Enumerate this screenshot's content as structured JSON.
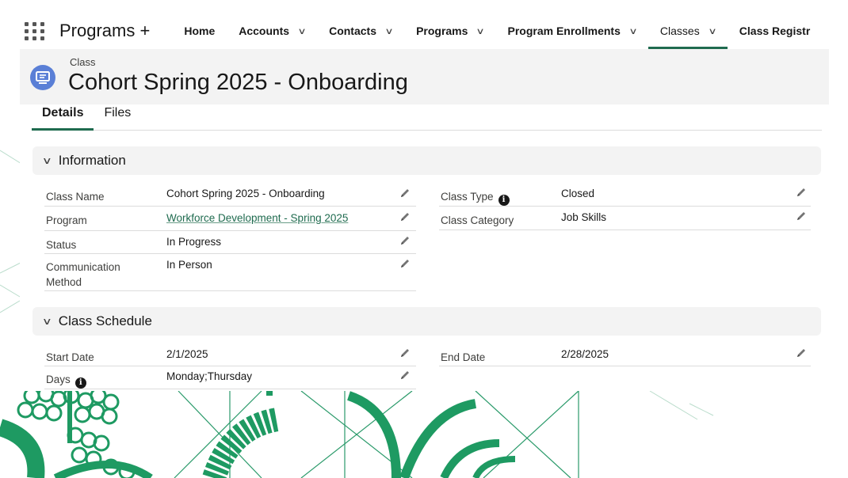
{
  "app": {
    "name": "Programs +"
  },
  "nav": {
    "items": [
      {
        "label": "Home",
        "has_menu": false,
        "active": false
      },
      {
        "label": "Accounts",
        "has_menu": true,
        "active": false
      },
      {
        "label": "Contacts",
        "has_menu": true,
        "active": false
      },
      {
        "label": "Programs",
        "has_menu": true,
        "active": false
      },
      {
        "label": "Program Enrollments",
        "has_menu": true,
        "active": false
      },
      {
        "label": "Classes",
        "has_menu": true,
        "active": true
      },
      {
        "label": "Class Registr",
        "has_menu": false,
        "active": false
      }
    ]
  },
  "record": {
    "object_type": "Class",
    "title": "Cohort Spring 2025 - Onboarding"
  },
  "tabs": [
    "Details",
    "Files"
  ],
  "sections": {
    "information": {
      "title": "Information"
    },
    "schedule": {
      "title": "Class Schedule"
    }
  },
  "fields": {
    "class_name": {
      "label": "Class Name",
      "value": "Cohort Spring 2025 - Onboarding"
    },
    "program": {
      "label": "Program",
      "value": "Workforce Development - Spring 2025"
    },
    "status": {
      "label": "Status",
      "value": "In Progress"
    },
    "communication_method": {
      "label_line1": "Communication",
      "label_line2": "Method",
      "value": "In Person"
    },
    "class_type": {
      "label": "Class Type",
      "value": "Closed"
    },
    "class_category": {
      "label": "Class Category",
      "value": "Job Skills"
    },
    "start_date": {
      "label": "Start Date",
      "value": "2/1/2025"
    },
    "days": {
      "label": "Days",
      "value": "Monday;Thursday"
    },
    "end_date": {
      "label": "End Date",
      "value": "2/28/2025"
    }
  },
  "icons": {
    "app_launcher": "waffle-icon",
    "nav_menu": "chevron-down-icon",
    "object": "class-record-icon",
    "section_toggle": "chevron-down-icon",
    "edit": "pencil-icon",
    "help": "info-icon"
  },
  "colors": {
    "accent": "#1f6b4f",
    "header_bg": "#f3f3f3",
    "object_icon": "#5a7fd6",
    "background_art": "#1e9a62"
  }
}
